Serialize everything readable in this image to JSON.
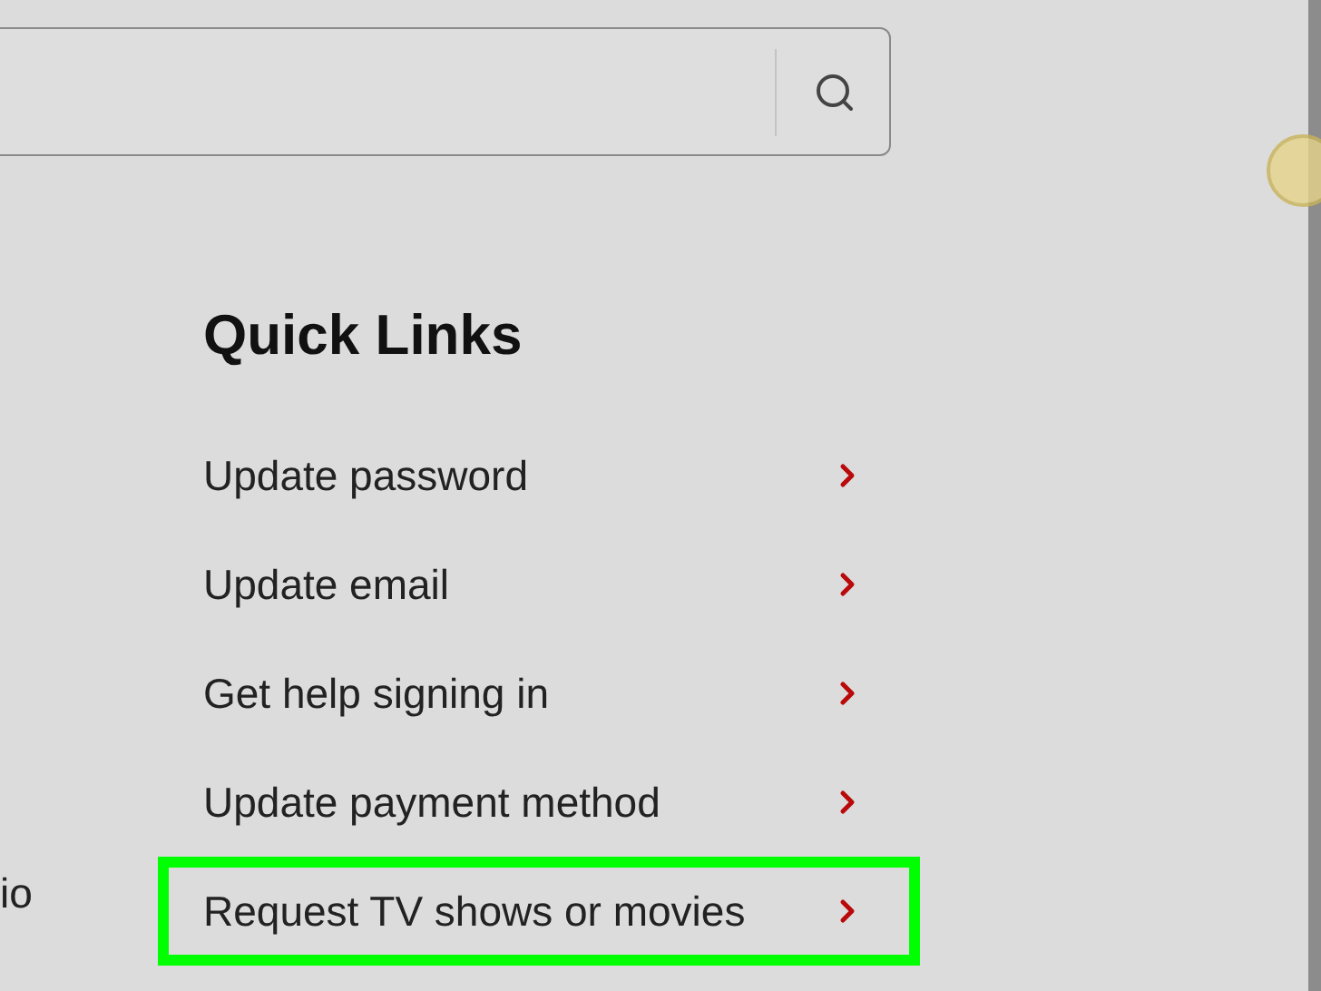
{
  "sidebar_fragment": "io",
  "quick_links": {
    "title": "Quick Links",
    "items": [
      {
        "label": "Update password",
        "highlighted": false
      },
      {
        "label": "Update email",
        "highlighted": false
      },
      {
        "label": "Get help signing in",
        "highlighted": false
      },
      {
        "label": "Update payment method",
        "highlighted": false
      },
      {
        "label": "Request TV shows or movies",
        "highlighted": true
      }
    ]
  }
}
